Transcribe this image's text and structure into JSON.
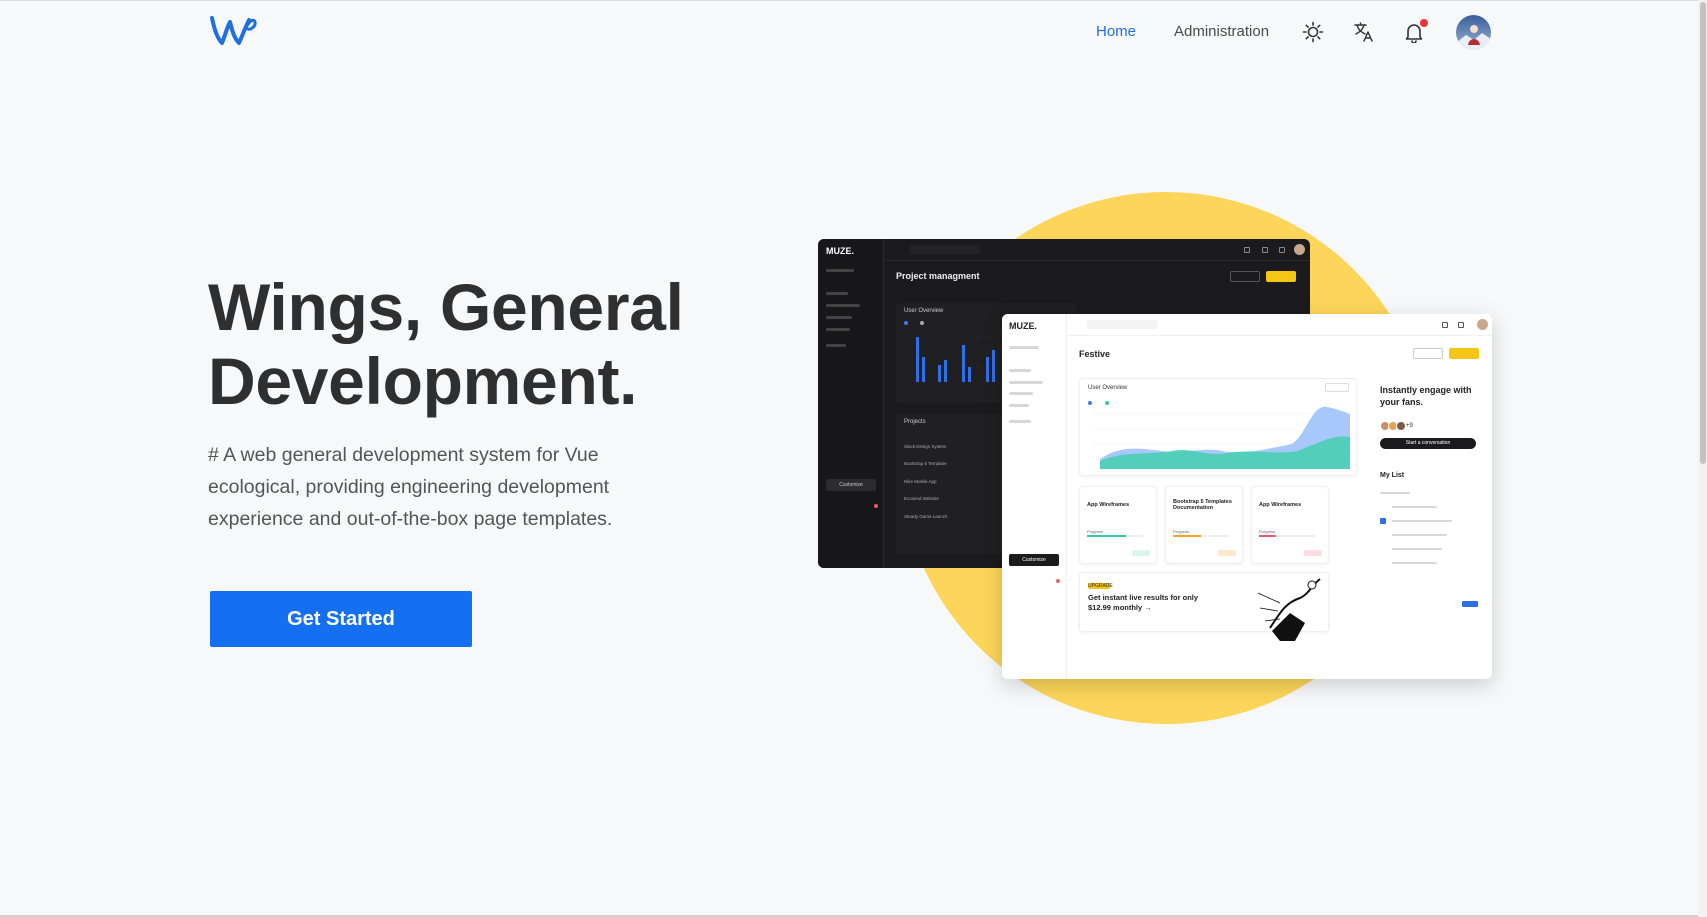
{
  "header": {
    "logo": "wings-logo",
    "nav": [
      {
        "label": "Home",
        "active": true
      },
      {
        "label": "Administration",
        "active": false
      }
    ],
    "icons": [
      "sun-icon",
      "translate-icon",
      "bell-icon"
    ],
    "notification_dot_color": "#f0303b"
  },
  "hero": {
    "title_line1": "Wings, General",
    "title_line2": "Development.",
    "description": "# A web general development system for Vue ecological, providing engineering development experience and out-of-the-box page templates.",
    "cta_label": "Get Started"
  },
  "mockup": {
    "dark": {
      "brand": "MUZE.",
      "title": "Project managment",
      "card_title": "User Overview",
      "projects_title": "Projects",
      "projects": [
        "Slack Design System",
        "Bootstrap 5 Template",
        "Nike Mobile App",
        "Ecosend Website",
        "Steady Game Launch"
      ],
      "customize": "Customize"
    },
    "light": {
      "brand": "MUZE.",
      "title": "Festive",
      "chart_title": "User Overview",
      "cards": [
        {
          "title": "App Wireframes",
          "status": "Progress"
        },
        {
          "title": "Bootstrap 5 Templates Documentation",
          "status": "Progress"
        },
        {
          "title": "App Wireframes",
          "status": "Progress"
        }
      ],
      "engage": "Instantly engage with your fans.",
      "avatar_count": "+9",
      "start_btn": "Start a conversation",
      "list_title": "My List",
      "promo_badge": "UPGRADE",
      "promo": "Get instant live results for only $12.99 monthly →",
      "customize": "Customize"
    }
  },
  "colors": {
    "accent": "#1470f0",
    "yellow": "#fdd55a",
    "background": "#f7f8fa"
  }
}
